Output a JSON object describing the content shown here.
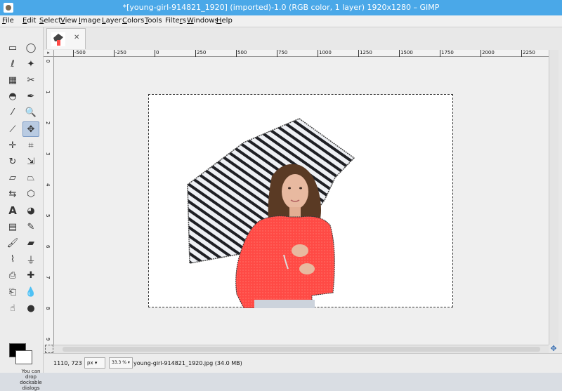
{
  "window": {
    "title": "*[young-girl-914821_1920] (imported)-1.0 (RGB color, 1 layer) 1920x1280 – GIMP"
  },
  "menubar": {
    "items": [
      {
        "label": "File",
        "mn": "F",
        "rest": "ile"
      },
      {
        "label": "Edit",
        "mn": "E",
        "rest": "dit"
      },
      {
        "label": "Select",
        "mn": "S",
        "rest": "elect"
      },
      {
        "label": "View",
        "mn": "V",
        "rest": "iew"
      },
      {
        "label": "Image",
        "mn": "I",
        "rest": "mage"
      },
      {
        "label": "Layer",
        "mn": "L",
        "rest": "ayer"
      },
      {
        "label": "Colors",
        "mn": "C",
        "rest": "olors"
      },
      {
        "label": "Tools",
        "mn": "T",
        "rest": "ools"
      },
      {
        "label": "Filters",
        "mn": "r",
        "pre": "Filte",
        "rest": "s"
      },
      {
        "label": "Windows",
        "mn": "W",
        "rest": "indows"
      },
      {
        "label": "Help",
        "mn": "H",
        "rest": "elp"
      }
    ]
  },
  "toolbox": {
    "tools": [
      {
        "name": "rect-select-tool-icon",
        "glyph": "▭"
      },
      {
        "name": "ellipse-select-tool-icon",
        "glyph": "◯"
      },
      {
        "name": "free-select-tool-icon",
        "glyph": "ℓ"
      },
      {
        "name": "fuzzy-select-tool-icon",
        "glyph": "✦"
      },
      {
        "name": "select-by-color-tool-icon",
        "glyph": "▦"
      },
      {
        "name": "scissors-select-tool-icon",
        "glyph": "✂"
      },
      {
        "name": "foreground-select-tool-icon",
        "glyph": "◓"
      },
      {
        "name": "paths-tool-icon",
        "glyph": "✒"
      },
      {
        "name": "color-picker-tool-icon",
        "glyph": "⁄"
      },
      {
        "name": "zoom-tool-icon",
        "glyph": "🔍"
      },
      {
        "name": "measure-tool-icon",
        "glyph": "⟋"
      },
      {
        "name": "move-tool-icon",
        "glyph": "✥"
      },
      {
        "name": "align-tool-icon",
        "glyph": "✛"
      },
      {
        "name": "crop-tool-icon",
        "glyph": "⌗"
      },
      {
        "name": "rotate-tool-icon",
        "glyph": "↻"
      },
      {
        "name": "scale-tool-icon",
        "glyph": "⇲"
      },
      {
        "name": "shear-tool-icon",
        "glyph": "▱"
      },
      {
        "name": "perspective-tool-icon",
        "glyph": "⏢"
      },
      {
        "name": "flip-tool-icon",
        "glyph": "⇆"
      },
      {
        "name": "cage-transform-tool-icon",
        "glyph": "⬡"
      },
      {
        "name": "text-tool-icon",
        "glyph": "A"
      },
      {
        "name": "bucket-fill-tool-icon",
        "glyph": "◕"
      },
      {
        "name": "blend-tool-icon",
        "glyph": "▤"
      },
      {
        "name": "pencil-tool-icon",
        "glyph": "✎"
      },
      {
        "name": "paintbrush-tool-icon",
        "glyph": "🖌"
      },
      {
        "name": "eraser-tool-icon",
        "glyph": "▰"
      },
      {
        "name": "airbrush-tool-icon",
        "glyph": "⌇"
      },
      {
        "name": "ink-tool-icon",
        "glyph": "⏚"
      },
      {
        "name": "clone-tool-icon",
        "glyph": "⎙"
      },
      {
        "name": "heal-tool-icon",
        "glyph": "✚"
      },
      {
        "name": "perspective-clone-tool-icon",
        "glyph": "⎗"
      },
      {
        "name": "blur-sharpen-tool-icon",
        "glyph": "💧"
      },
      {
        "name": "smudge-tool-icon",
        "glyph": "☝"
      },
      {
        "name": "dodge-burn-tool-icon",
        "glyph": "●"
      }
    ],
    "dock_hint": "You can drop dockable dialogs"
  },
  "ruler": {
    "h_labels": [
      "-500",
      "-250",
      "0",
      "250",
      "500",
      "750",
      "1000",
      "1250",
      "1500",
      "1750",
      "2000",
      "2250"
    ],
    "v_labels": [
      "0",
      "1",
      "2",
      "3",
      "4",
      "5",
      "6",
      "7",
      "8",
      "9"
    ]
  },
  "status": {
    "coords": "1110, 723",
    "unit": "px",
    "zoom": "33.3 %",
    "file_info": "young-girl-914821_1920.jpg (34.0 MB)"
  },
  "colors": {
    "titlebar": "#4aa8e8",
    "sweater": "#ff4a45",
    "active_tool": "#b9cbe2"
  }
}
